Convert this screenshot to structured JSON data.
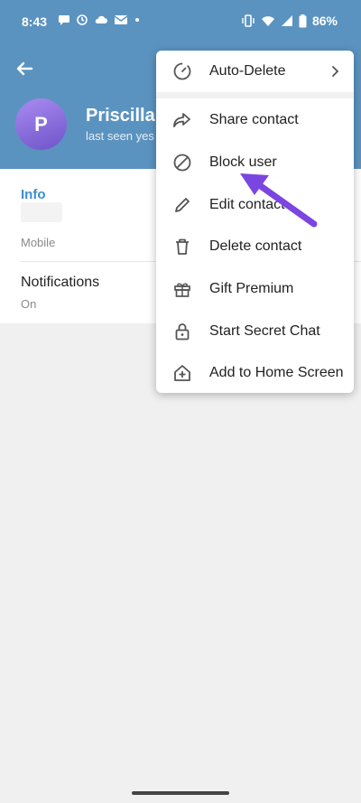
{
  "status_bar": {
    "time": "8:43",
    "battery": "86%",
    "left_icons": [
      "chat-bubble-icon",
      "sync-icon",
      "cloud-icon",
      "outlook-icon",
      "dot-icon"
    ],
    "right_icons": [
      "vibrate-icon",
      "wifi-icon",
      "signal-icon",
      "battery-icon"
    ]
  },
  "profile": {
    "avatar_initial": "P",
    "name": "Priscilla",
    "status": "last seen yes"
  },
  "info": {
    "heading": "Info",
    "phone_label": "Mobile",
    "notifications_title": "Notifications",
    "notifications_value": "On"
  },
  "menu": {
    "items": [
      {
        "label": "Auto-Delete",
        "icon": "timer-icon"
      },
      {
        "label": "Share contact",
        "icon": "share-icon"
      },
      {
        "label": "Block user",
        "icon": "block-icon"
      },
      {
        "label": "Edit contact",
        "icon": "pencil-icon"
      },
      {
        "label": "Delete contact",
        "icon": "trash-icon"
      },
      {
        "label": "Gift Premium",
        "icon": "gift-icon"
      },
      {
        "label": "Start Secret Chat",
        "icon": "lock-icon"
      },
      {
        "label": "Add to Home Screen",
        "icon": "add-home-icon"
      }
    ]
  },
  "colors": {
    "header": "#5b93c0",
    "accent_blue": "#3a8fd0",
    "arrow_purple": "#7b45e0",
    "avatar_start": "#a98bf2",
    "avatar_end": "#6f53c8"
  }
}
